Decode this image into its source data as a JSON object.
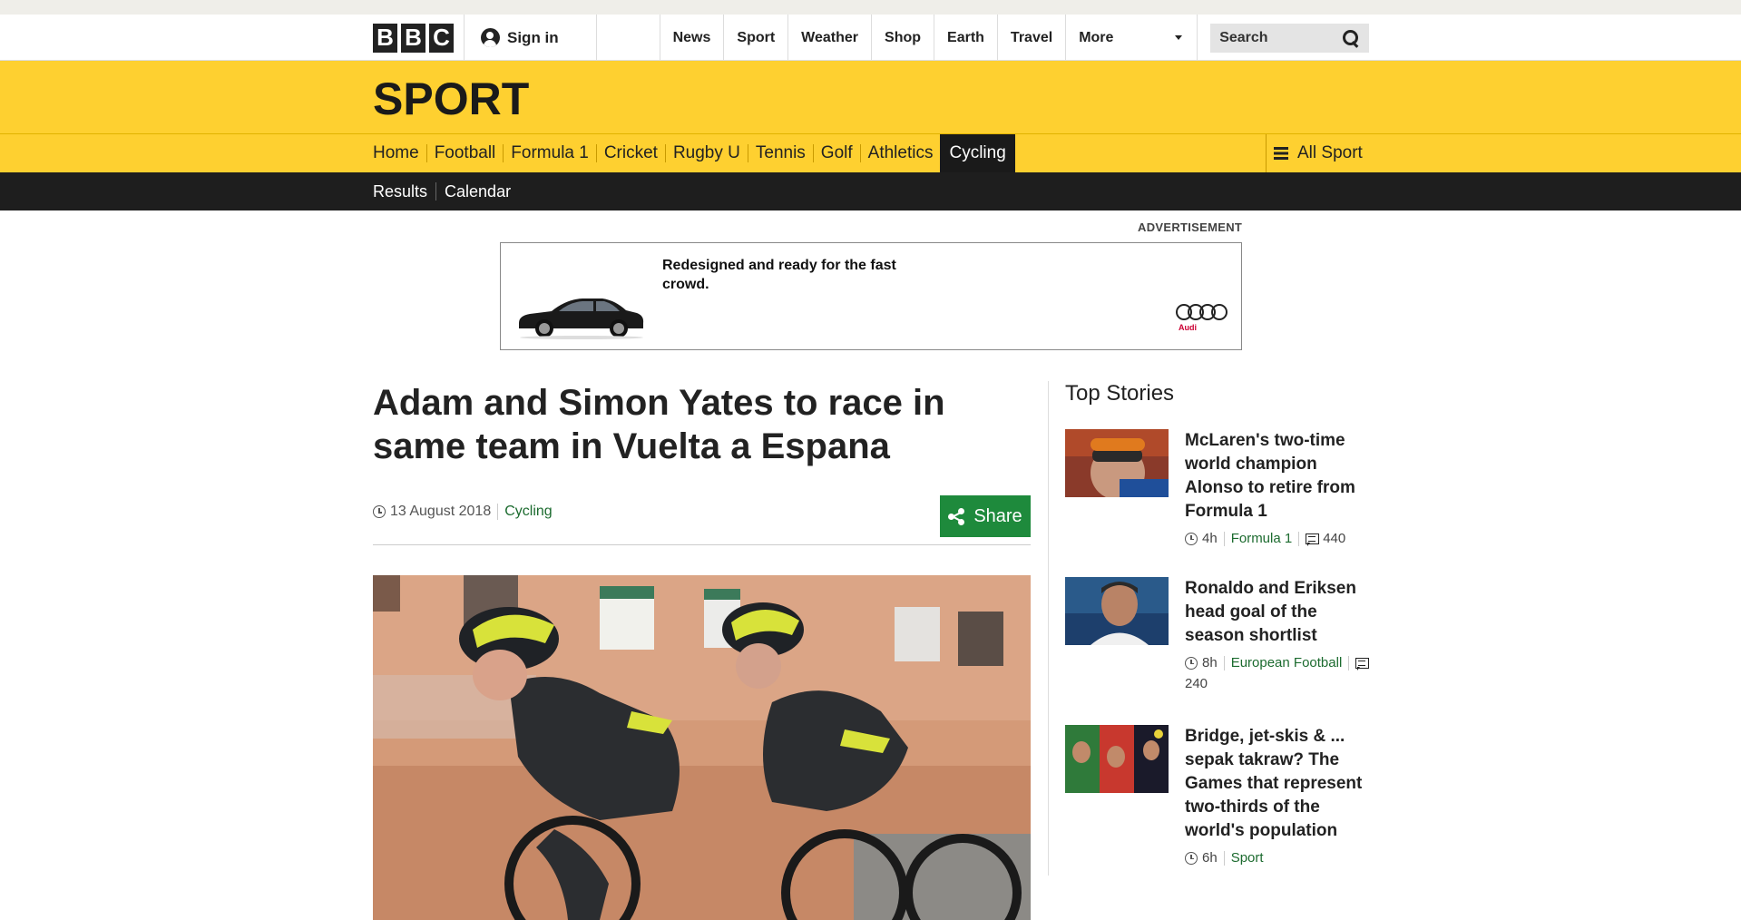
{
  "logo": {
    "letters": [
      "B",
      "B",
      "C"
    ]
  },
  "header": {
    "signin_label": "Sign in",
    "nav": [
      "News",
      "Sport",
      "Weather",
      "Shop",
      "Earth",
      "Travel",
      "More"
    ],
    "search_placeholder": "Search"
  },
  "sport": {
    "title": "SPORT",
    "nav": [
      "Home",
      "Football",
      "Formula 1",
      "Cricket",
      "Rugby U",
      "Tennis",
      "Golf",
      "Athletics",
      "Cycling"
    ],
    "active": "Cycling",
    "all_sport": "All Sport",
    "subnav": [
      "Results",
      "Calendar"
    ]
  },
  "ad": {
    "label": "ADVERTISEMENT",
    "text": "Redesigned and ready for the fast crowd.",
    "brand": "Audi"
  },
  "article": {
    "headline": "Adam and Simon Yates to race in same team in Vuelta a Espana",
    "date": "13 August 2018",
    "category": "Cycling",
    "share_label": "Share"
  },
  "top_stories": {
    "title": "Top Stories",
    "items": [
      {
        "title": "McLaren's two-time world champion Alonso to retire from Formula 1",
        "time": "4h",
        "category": "Formula 1",
        "comments": "440"
      },
      {
        "title": "Ronaldo and Eriksen head goal of the season shortlist",
        "time": "8h",
        "category": "European Football",
        "comments": "240"
      },
      {
        "title": "Bridge, jet-skis & ... sepak takraw? The Games that represent two-thirds of the world's population",
        "time": "6h",
        "category": "Sport"
      }
    ]
  },
  "colors": {
    "sport_yellow": "#fed030",
    "share_green": "#1e8a3c",
    "link_green": "#1c6b2f",
    "subnav_black": "#1e1e1e"
  }
}
